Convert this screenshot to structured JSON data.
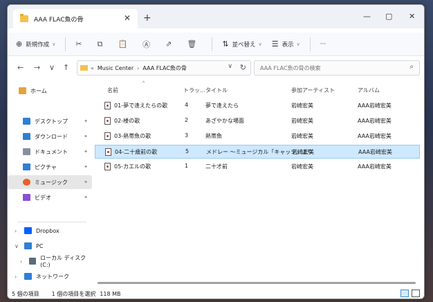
{
  "window": {
    "tab_title": "AAA FLAC魚の骨",
    "tab_close": "✕",
    "new_tab": "+",
    "controls": {
      "minimize": "—",
      "maximize": "▢",
      "close": "✕"
    }
  },
  "toolbar": {
    "new_label": "新規作成",
    "sort_label": "並べ替え",
    "view_label": "表示",
    "more": "···",
    "icons": [
      "plus-circle-icon",
      "cut-icon",
      "copy-icon",
      "paste-icon",
      "rename-icon",
      "share-icon",
      "delete-icon"
    ]
  },
  "address": {
    "back": "←",
    "forward": "→",
    "recent": "∨",
    "up": "↑",
    "overflow": "«",
    "crumbs": [
      "Music Center",
      "AAA FLAC魚の骨"
    ],
    "crumb_sep": "›",
    "dropdown": "∨",
    "refresh": "↻"
  },
  "search": {
    "placeholder": "AAA FLAC魚の骨の検索",
    "icon": "⌕"
  },
  "sidebar": {
    "home": "ホーム",
    "quick": [
      {
        "label": "デスクトップ",
        "color": "#2f7fd6"
      },
      {
        "label": "ダウンロード",
        "color": "#2f7fd6"
      },
      {
        "label": "ドキュメント",
        "color": "#8a8fa0"
      },
      {
        "label": "ピクチャ",
        "color": "#2f7fd6"
      },
      {
        "label": "ミュージック",
        "color": "#e8612c"
      },
      {
        "label": "ビデオ",
        "color": "#8b4ed6"
      }
    ],
    "pin": "📌",
    "tree": [
      {
        "label": "Dropbox",
        "color": "#0061fe",
        "exp": "›"
      },
      {
        "label": "PC",
        "color": "#2f7fd6",
        "exp": "∨"
      },
      {
        "label": "ローカル ディスク (C:)",
        "color": "#5a6b7d",
        "exp": "›"
      },
      {
        "label": "ネットワーク",
        "color": "#2f7fd6",
        "exp": "›"
      }
    ]
  },
  "columns": {
    "name": "名前",
    "track": "トラッ...",
    "title": "タイトル",
    "artist": "参加アーティスト",
    "album": "アルバム",
    "sort_arrow": "^"
  },
  "files": [
    {
      "name": "01-夢で逢えたらの歌",
      "track": "4",
      "title": "夢で逢えたら",
      "artist": "岩崎宏美",
      "album": "AAA岩崎宏美",
      "selected": false
    },
    {
      "name": "02-楼の歌",
      "track": "2",
      "title": "あざやかな場面",
      "artist": "岩崎宏美",
      "album": "AAA岩崎宏美",
      "selected": false
    },
    {
      "name": "03-熱帯魚の歌",
      "track": "3",
      "title": "熱帯魚",
      "artist": "岩崎宏美",
      "album": "AAA岩崎宏美",
      "selected": false
    },
    {
      "name": "04-二十歳前の歌",
      "track": "5",
      "title": "メドレー ～ミュージカル「キャッツ」より",
      "artist": "岩崎宏美",
      "album": "AAA岩崎宏美",
      "selected": true
    },
    {
      "name": "05-カエルの歌",
      "track": "1",
      "title": "二十才前",
      "artist": "岩崎宏美",
      "album": "AAA岩崎宏美",
      "selected": false
    }
  ],
  "status": {
    "count": "5 個の項目",
    "selection": "1 個の項目を選択",
    "size": "118 MB"
  }
}
